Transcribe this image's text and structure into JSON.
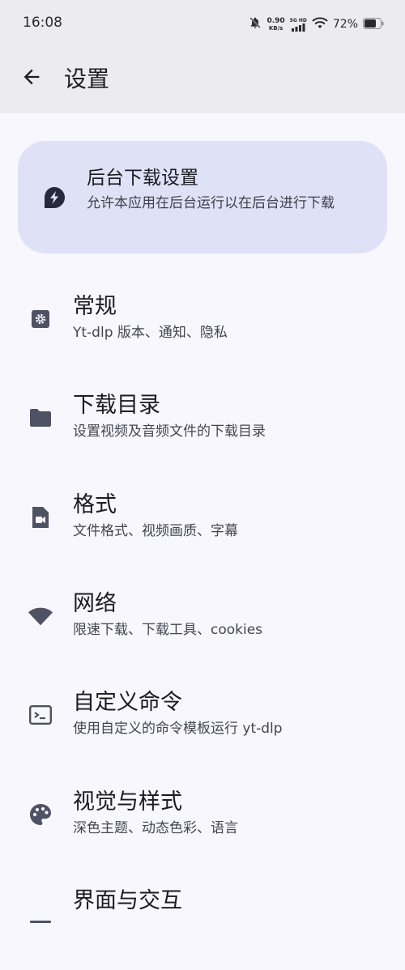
{
  "status_bar": {
    "time": "16:08",
    "net_speed_value": "0.90",
    "net_speed_unit": "KB/s",
    "network_type": "5G HD",
    "battery": "72%"
  },
  "app_bar": {
    "title": "设置",
    "back_icon": "arrow-back-icon"
  },
  "banner": {
    "icon": "bolt-icon",
    "title": "后台下载设置",
    "description": "允许本应用在后台运行以在后台进行下载"
  },
  "settings": [
    {
      "icon": "gear-square-icon",
      "title": "常规",
      "description": "Yt-dlp 版本、通知、隐私"
    },
    {
      "icon": "folder-icon",
      "title": "下载目录",
      "description": "设置视频及音频文件的下载目录"
    },
    {
      "icon": "video-file-icon",
      "title": "格式",
      "description": "文件格式、视频画质、字幕"
    },
    {
      "icon": "wifi-icon",
      "title": "网络",
      "description": "限速下载、下载工具、cookies"
    },
    {
      "icon": "terminal-icon",
      "title": "自定义命令",
      "description": "使用自定义的命令模板运行 yt-dlp"
    },
    {
      "icon": "palette-icon",
      "title": "视觉与样式",
      "description": "深色主题、动态色彩、语言"
    },
    {
      "icon": "touch-icon",
      "title": "界面与交互",
      "description": ""
    }
  ],
  "colors": {
    "background": "#f7f7fd",
    "app_bar": "#ececf0",
    "banner": "#dfe1f7",
    "icon": "#4f5264"
  }
}
